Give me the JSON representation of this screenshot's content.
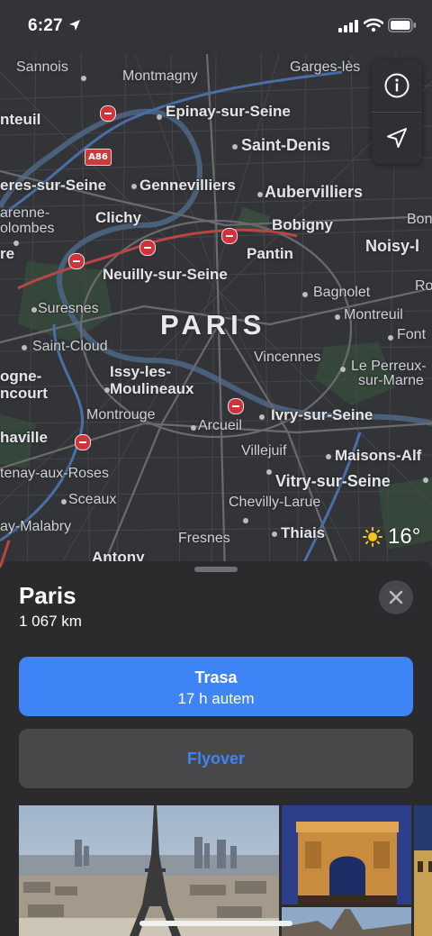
{
  "status": {
    "time": "6:27"
  },
  "map": {
    "city": "PARIS",
    "places": [
      "Sannois",
      "Montmagny",
      "Garges-lès",
      "nteuil",
      "Epinay-sur-Seine",
      "Saint-Denis",
      "eres-sur-Seine",
      "Gennevilliers",
      "Aubervilliers",
      "arenne-",
      "olombes",
      "Clichy",
      "Bobigny",
      "Bon",
      "Pantin",
      "Noisy-l",
      "re",
      "Neuilly-sur-Seine",
      "Ro",
      "Bagnolet",
      "Suresnes",
      "Montreuil",
      "Font",
      "Saint-Cloud",
      "Vincennes",
      "Le Perreux-",
      "sur-Marne",
      "ogne-",
      "ncourt",
      "Issy-les-",
      "Moulineaux",
      "Montrouge",
      "Arcueil",
      "Ivry-sur-Seine",
      "haville",
      "Villejuif",
      "Maisons-Alf",
      "tenay-aux-Roses",
      "Vitry-sur-Seine",
      "Sceaux",
      "Chevilly-Larue",
      "Thiais",
      "ay-Malabry",
      "Fresnes",
      "Antony"
    ],
    "highway_shield": "A86",
    "weather": {
      "icon": "sun-icon",
      "temperature": "16°"
    },
    "controls": {
      "info_icon": "info-icon",
      "location_icon": "location-arrow-icon"
    }
  },
  "sheet": {
    "title": "Paris",
    "distance": "1 067 km",
    "route_button": {
      "label": "Trasa",
      "eta": "17 h autem"
    },
    "flyover_button": {
      "label": "Flyover"
    },
    "photos": [
      "eiffel-tower-photo",
      "arc-de-triomphe-photo",
      "notre-dame-photo",
      "palace-photo"
    ]
  },
  "colors": {
    "accent": "#3E84F7",
    "sheet": "#2B2B2D",
    "map": "#333437"
  }
}
